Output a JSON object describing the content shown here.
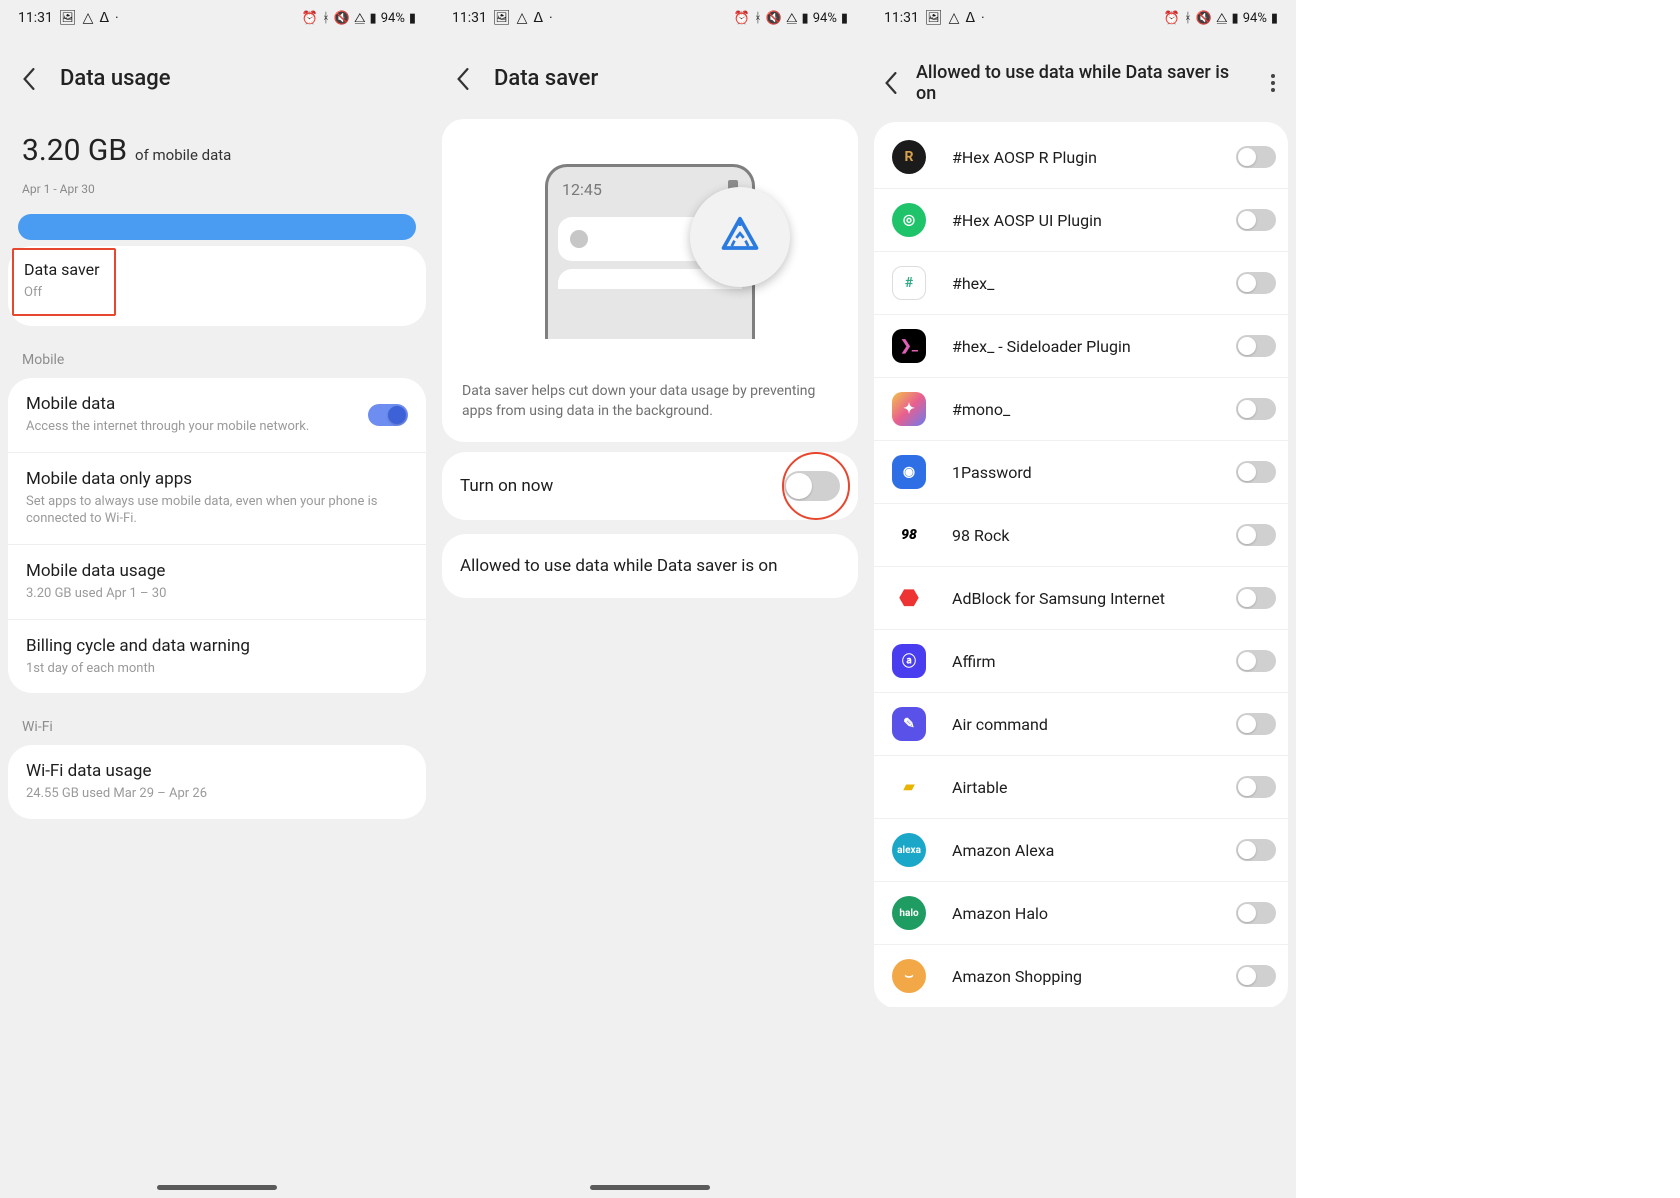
{
  "status": {
    "time": "11:31",
    "battery_pct": "94%"
  },
  "screen1": {
    "title": "Data usage",
    "total_gb": "3.20 GB",
    "total_sub": "of mobile data",
    "period": "Apr 1 - Apr 30",
    "bar_min": "0 B",
    "bar_max": "3.20 GB",
    "datasaver": {
      "title": "Data saver",
      "status": "Off"
    },
    "sect_mobile": "Mobile",
    "mobile_data": {
      "title": "Mobile data",
      "sub": "Access the internet through your mobile network."
    },
    "only_apps": {
      "title": "Mobile data only apps",
      "sub": "Set apps to always use mobile data, even when your phone is connected to Wi-Fi."
    },
    "mobile_usage": {
      "title": "Mobile data usage",
      "sub": "3.20 GB used Apr 1 – 30"
    },
    "billing": {
      "title": "Billing cycle and data warning",
      "sub": "1st day of each month"
    },
    "sect_wifi": "Wi-Fi",
    "wifi_usage": {
      "title": "Wi-Fi data usage",
      "sub": "24.55 GB used Mar 29 – Apr 26"
    }
  },
  "screen2": {
    "title": "Data saver",
    "illus_time": "12:45",
    "desc": "Data saver helps cut down your data usage by preventing apps from using data in the background.",
    "turn_on": "Turn on now",
    "allowed": "Allowed to use data while Data saver is on"
  },
  "screen3": {
    "title": "Allowed to use data while Data saver is on",
    "apps": [
      {
        "name": "#Hex AOSP R Plugin",
        "bg": "#2b2b2b"
      },
      {
        "name": "#Hex AOSP UI Plugin",
        "bg": "#22c26a"
      },
      {
        "name": "#hex_",
        "bg": "#ffffff"
      },
      {
        "name": "#hex_ - Sideloader Plugin",
        "bg": "#000000"
      },
      {
        "name": "#mono_",
        "bg": "linear"
      },
      {
        "name": "1Password",
        "bg": "#3071e8"
      },
      {
        "name": "98 Rock",
        "bg": "#ffffff"
      },
      {
        "name": "AdBlock for Samsung Internet",
        "bg": "#ffffff"
      },
      {
        "name": "Affirm",
        "bg": "#4a3df0"
      },
      {
        "name": "Air command",
        "bg": "#5a52e8"
      },
      {
        "name": "Airtable",
        "bg": "#ffffff"
      },
      {
        "name": "Amazon Alexa",
        "bg": "#1ba8c9"
      },
      {
        "name": "Amazon Halo",
        "bg": "#1f9c62"
      },
      {
        "name": "Amazon Shopping",
        "bg": "#f3a847"
      }
    ]
  }
}
